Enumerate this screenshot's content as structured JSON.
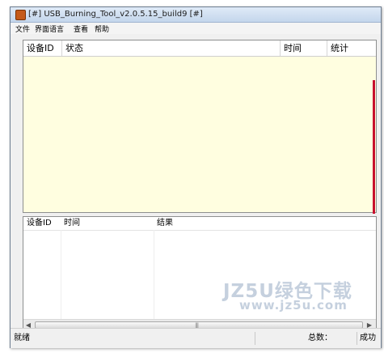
{
  "window": {
    "title": "[#] USB_Burning_Tool_v2.0.5.15_build9 [#]"
  },
  "menu": {
    "items": [
      "文件",
      "界面语言",
      "查看",
      "帮助"
    ]
  },
  "device_table": {
    "columns": [
      "设备ID",
      "状态",
      "时间",
      "统计"
    ],
    "background": "#fffee0"
  },
  "result_table": {
    "columns": [
      "设备ID",
      "时间",
      "结果"
    ]
  },
  "status_bar": {
    "ready": "就绪",
    "total_label": "总数：",
    "success_label": "成功"
  },
  "watermark": {
    "line1": "JZ5U绿色下载",
    "line2": "www.jz5u.com"
  },
  "colors": {
    "accent_bar": "#c8102e",
    "app_icon": "#c55a1a"
  },
  "icons": {
    "app": "usb-tool-app-icon",
    "scroll_left": "scroll-left-arrow-icon",
    "scroll_right": "scroll-right-arrow-icon"
  }
}
